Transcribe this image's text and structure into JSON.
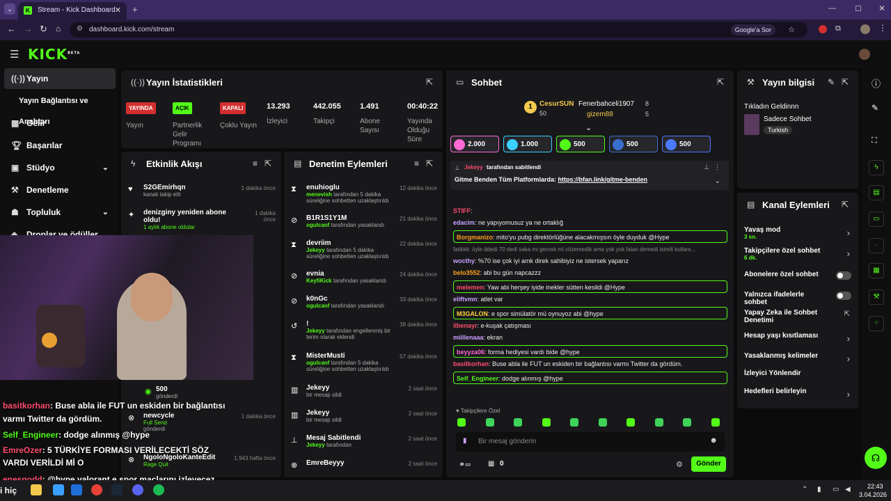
{
  "browser": {
    "tab_title": "Stream - Kick Dashboard",
    "url": "dashboard.kick.com/stream",
    "google_btn": "Google'a Sor"
  },
  "logo": "KICK",
  "logo_sup": "BETA",
  "sidebar": [
    {
      "label": "Yayın",
      "icon": "broadcast-icon"
    },
    {
      "label": "Yayın Bağlantısı ve Anahtarı",
      "icon": ""
    },
    {
      "label": "Gelir",
      "icon": "income-icon"
    },
    {
      "label": "Başarılar",
      "icon": "trophy-icon"
    },
    {
      "label": "Stüdyo",
      "icon": "studio-icon"
    },
    {
      "label": "Denetleme",
      "icon": "moderation-icon"
    },
    {
      "label": "Topluluk",
      "icon": "community-icon"
    },
    {
      "label": "Droplar ve ödüller",
      "icon": "drops-icon"
    }
  ],
  "stats": {
    "title": "Yayın İstatistikleri",
    "yayin_badge": "YAYINDA",
    "yayin_label": "Yayın",
    "partner_badge": "AÇIK",
    "partner_label": "Partnerlik Gelir Programı",
    "coklu_badge": "KAPALI",
    "coklu_label": "Çoklu Yayın",
    "viewers": "13.293",
    "viewers_label": "İzleyici",
    "followers": "442.055",
    "followers_label": "Takipçi",
    "subs": "1.491",
    "subs_label": "Abone Sayısı",
    "time": "00:40:22",
    "time_label": "Yayında Olduğu Süre"
  },
  "activity": {
    "title": "Etkinlik Akışı",
    "items": [
      {
        "name": "S2GEmirhqn",
        "sub": "kanalı takip etti",
        "time": "1 dakika önce"
      },
      {
        "name": "denizginy yeniden abone oldu!",
        "sub": "1 aylık abone oldular",
        "time": "1 dakika önce"
      },
      {
        "name": "newcycle",
        "sub": "Full Send",
        "time": "1 dakika önce"
      },
      {
        "name": "NgoloNgoloKanteEdit",
        "sub": "Rage Quit",
        "time": "1.943 hafta önce"
      }
    ],
    "gift_amount": "500",
    "gift_sub": "gönderdi",
    "gonderdi": "gönderdi"
  },
  "moderation": {
    "title": "Denetim Eylemleri",
    "items": [
      {
        "name": "enuhioglu",
        "who": "menevish",
        "text": "tarafından 5 dakika süreliğine sohbetten uzaklaştırıldı",
        "time": "12 dakika önce"
      },
      {
        "name": "B1R1S1Y1M",
        "who": "ogulcanf",
        "text": "tarafından yasaklandı",
        "time": "21 dakika önce"
      },
      {
        "name": "devriim",
        "who": "Jekeyy",
        "text": "tarafından 5 dakika süreliğine sohbetten uzaklaştırıldı",
        "time": "22 dakika önce"
      },
      {
        "name": "evnia",
        "who": "KeyfiKick",
        "text": "tarafından yasaklandı",
        "time": "24 dakika önce"
      },
      {
        "name": "k0nGc",
        "who": "ogulcanf",
        "text": "tarafından yasaklandı",
        "time": "33 dakika önce"
      },
      {
        "name": "!",
        "who": "Jekeyy",
        "text": "tarafından engellenmiş bir terim olarak eklendi",
        "time": "38 dakika önce"
      },
      {
        "name": "MisterMusti",
        "who": "ogulcanf",
        "text": "tarafından 5 dakika süreliğine sohbetten uzaklaştırıldı",
        "time": "57 dakika önce"
      },
      {
        "name": "Jekeyy",
        "who": "",
        "text": "bir mesajı sildi",
        "time": "2 saat önce"
      },
      {
        "name": "Jekeyy",
        "who": "",
        "text": "bir mesajı sildi",
        "time": "2 saat önce"
      },
      {
        "name": "Mesaj Sabitlendi",
        "who": "Jekeyy",
        "text": "tarafından",
        "time": "2 saat önce"
      },
      {
        "name": "EmreBeyyy",
        "who": "",
        "text": "",
        "time": "2 saat önce"
      }
    ]
  },
  "chat": {
    "title": "Sohbet",
    "top1_name": "CesurSUN",
    "top1_val": "50",
    "top2_name": "Fenerbahceli1907",
    "top2_val": "8",
    "top3_name": "gizem88",
    "top3_val": "5",
    "gifts": [
      "2.000",
      "1.000",
      "500",
      "500",
      "500"
    ],
    "pinned_by": "Jekeyy",
    "pinned_label": "tarafından sabitlendi",
    "pinned_text": "Gitme Benden Tüm Platformlarda: ",
    "pinned_link": "https://bfan.link/gitme-benden",
    "messages": [
      {
        "user": "STIFF",
        "color": "#ff4d6d",
        "text": ""
      },
      {
        "user": "edacim",
        "color": "#c9a0ff",
        "text": "ne yapıyomusuz ya ne ortaklığ"
      },
      {
        "user": "Borgmanizo",
        "color": "#ff9f1c",
        "text": "mito'yu pubg direktörlüğüne alacakmışsın öyle duyduk @Hype",
        "hl": true
      },
      {
        "user": "",
        "color": "#888",
        "text": "fatikkk: öyle ddedi 70 dedi saka mi gercek mi cözemedik ama yok yok falan demedi isimili kullanı..."
      },
      {
        "user": "wocthy",
        "color": "#c9a0ff",
        "text": "%70 ise çok iyi amk direk sahibiyiz ne istersek yaparız"
      },
      {
        "user": "belo3552",
        "color": "#ff9f1c",
        "text": "abi bu gün napcazzz"
      },
      {
        "user": "melemen",
        "color": "#ff4d6d",
        "text": "Yaw abi herşey iyide inekler sütten kesildi @Hype",
        "hl": true
      },
      {
        "user": "eliftvmn",
        "color": "#c9a0ff",
        "text": "atlet var"
      },
      {
        "user": "M3GALON",
        "color": "#ffd23f",
        "text": "e spor simülatör mü oynuyoz abi @hype",
        "hl": true
      },
      {
        "user": "ilbenayr",
        "color": "#ff4d6d",
        "text": "e-kuşak çatışması"
      },
      {
        "user": "miillenaaa",
        "color": "#c9a0ff",
        "text": "ekran"
      },
      {
        "user": "beyyza06",
        "color": "#ff6ad5",
        "text": "forma hediyesi vardı bide @hype",
        "hl": true
      },
      {
        "user": "basitkorhan",
        "color": "#ff4d6d",
        "text": "Buse abla ile FUT un eskiden bir bağlantısı varmı Twitter da gördüm."
      },
      {
        "user": "Self_Engineer",
        "color": "#53fc18",
        "text": "dodge alınmış @hype",
        "hl": true
      }
    ],
    "followers_only": "Takipçilere Özel",
    "input_placeholder": "Bir mesaj gönderin",
    "send": "Gönder",
    "points": "0"
  },
  "streaminfo": {
    "title": "Yayın bilgisi",
    "stream_title": "Tıkladın Geldinnn",
    "category": "Sadece Sohbet",
    "language": "Turkish"
  },
  "channel": {
    "title": "Kanal Eylemleri",
    "items": [
      {
        "label": "Yavaş mod",
        "sub": "3 sn.",
        "type": "chev"
      },
      {
        "label": "Takipçilere özel sohbet",
        "sub": "6 dk.",
        "type": "chev"
      },
      {
        "label": "Abonelere özel sohbet",
        "sub": "",
        "type": "tog"
      },
      {
        "label": "Yalnızca ifadelerle sohbet",
        "sub": "",
        "type": "tog"
      },
      {
        "label": "Yapay Zeka ile Sohbet Denetimi",
        "sub": "",
        "type": "ext"
      },
      {
        "label": "Hesap yaşı kısıtlaması",
        "sub": "",
        "type": "chev"
      },
      {
        "label": "Yasaklanmış kelimeler",
        "sub": "",
        "type": "chev"
      },
      {
        "label": "İzleyici Yönlendir",
        "sub": "",
        "type": "none"
      },
      {
        "label": "Hedefleri belirleyin",
        "sub": "",
        "type": "chev"
      }
    ]
  },
  "overlay": [
    {
      "user": "basitkorhan",
      "text": ": Buse abla ile FUT un eskiden bir bağlantısı",
      "color": "#ff4d6d"
    },
    {
      "user": "",
      "text": "varmı Twitter da gördüm.",
      "color": "#fff"
    },
    {
      "user": "Self_Engineer",
      "text": ": dodge alınmış @hype",
      "color": "#53fc18"
    },
    {
      "user": "EmreOzer",
      "text": ": 5 TÜRKİYE FORMASI VERİLECEKTİ SÖZ",
      "color": "#ff4d6d"
    },
    {
      "user": "",
      "text": "VARDI VERİLDİ Mİ O",
      "color": "#fff"
    },
    {
      "user": "enesgodd",
      "text": ": @hype valorant e spor maçlarını izleyecez",
      "color": "#ff4d6d"
    }
  ],
  "taskbar": {
    "time": "22:43",
    "date": "3.04.2026",
    "search": "i hiç"
  },
  "colors": {
    "accent": "#53fc18",
    "panel": "#18181b",
    "bg": "#0b0b0c"
  }
}
